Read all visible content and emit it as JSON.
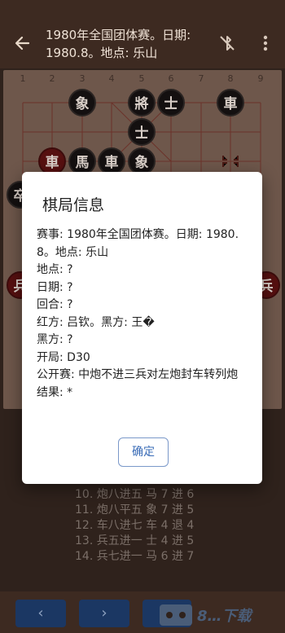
{
  "header": {
    "title": "1980年全国团体赛。日期: 1980.8。地点: 乐山",
    "back_icon": "arrow-left-icon",
    "bluetooth_icon": "bluetooth-off-icon",
    "more_icon": "more-vert-icon"
  },
  "board": {
    "file_numbers": [
      "1",
      "2",
      "3",
      "4",
      "5",
      "6",
      "7",
      "8",
      "9"
    ],
    "pieces": [
      {
        "char": "象",
        "side": "black"
      },
      {
        "char": "將",
        "side": "black"
      },
      {
        "char": "士",
        "side": "black"
      },
      {
        "char": "車",
        "side": "black"
      },
      {
        "char": "士",
        "side": "black"
      },
      {
        "char": "車",
        "side": "red"
      },
      {
        "char": "馬",
        "side": "black"
      },
      {
        "char": "車",
        "side": "black"
      },
      {
        "char": "象",
        "side": "black"
      },
      {
        "char": "卒",
        "side": "black"
      },
      {
        "char": "兵",
        "side": "red"
      },
      {
        "char": "兵",
        "side": "red"
      }
    ]
  },
  "dialog": {
    "title": "棋局信息",
    "lines": [
      "赛事: 1980年全国团体赛。日期: 1980.8。地点: 乐山",
      "地点: ?",
      "日期: ?",
      "回合: ?",
      "红方: 吕钦。黑方: 王�",
      "黑方: ?",
      "开局: D30",
      "公开赛: 中炮不进三兵对左炮封车转列炮",
      "结果: *"
    ],
    "ok_label": "确定"
  },
  "moves": [
    "10. 炮八进五  马 7 进 6",
    "11. 炮八平五  象 7 进 5",
    "12. 车八进七  车 4 退 4",
    "13. 兵五进一  士 4 进 5",
    "14. 兵七进一  马 6 进 7"
  ],
  "bottom_bar": {
    "prev_label": "‹",
    "next_label": "›",
    "watermark": "8…下载"
  },
  "colors": {
    "app_bar": "#3d2a21",
    "dialog_accent": "#3a6cb7",
    "nav_button": "#1b3763"
  }
}
